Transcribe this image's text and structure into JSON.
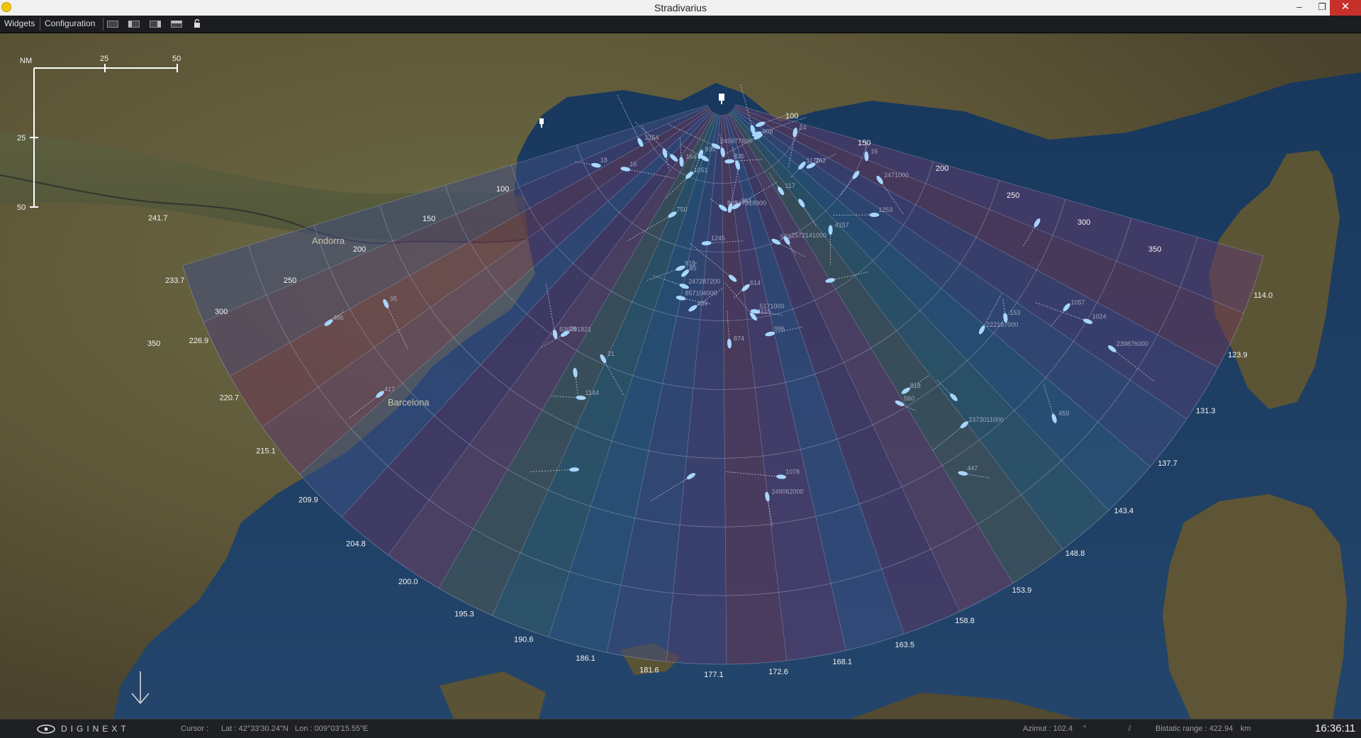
{
  "window": {
    "title": "Stradivarius",
    "minimize": "–",
    "restore": "❐",
    "close": "✕"
  },
  "menu": {
    "widgets": "Widgets",
    "configuration": "Configuration",
    "tools": [
      "layout-1-icon",
      "layout-2-icon",
      "layout-3-icon",
      "layout-4-icon",
      "lock-icon"
    ]
  },
  "scale_bar": {
    "unit": "NM",
    "h_ticks": [
      "25",
      "50"
    ],
    "v_ticks": [
      "25",
      "50"
    ]
  },
  "place_labels": {
    "andorra": "Andorra",
    "barcelona": "Barcelona"
  },
  "range_rings_east": [
    "100",
    "150",
    "200",
    "250",
    "300",
    "350"
  ],
  "range_rings_west": [
    "100",
    "150",
    "200",
    "250",
    "300",
    "350"
  ],
  "arc_labels": [
    "114.0",
    "123.9",
    "131.3",
    "137.7",
    "143.4",
    "148.8",
    "153.9",
    "158.8",
    "163.5",
    "168.1",
    "172.6",
    "177.1",
    "181.6",
    "186.1",
    "190.6",
    "195.3",
    "200.0",
    "204.8",
    "209.9",
    "215.1",
    "220.7",
    "226.9",
    "233.7",
    "241.7"
  ],
  "track_ids": [
    "874",
    "242",
    "1115",
    "1057",
    "65",
    "560",
    "935",
    "865",
    "1051",
    "439",
    "908",
    "486",
    "1253",
    "1254",
    "995",
    "750",
    "459",
    "353",
    "1245",
    "222187000",
    "573",
    "1024",
    "2373011000",
    "247318900",
    "918",
    "636091821",
    "1178",
    "835",
    "2471000",
    "21",
    "18",
    "5171000",
    "1078",
    "614",
    "117",
    "164",
    "818",
    "417",
    "95",
    "28",
    "245977600",
    "2572141000",
    "4157",
    "1144",
    "447",
    "16",
    "247287200",
    "239876000",
    "249062000",
    "857104000",
    "153",
    "16",
    "24"
  ],
  "north_arrow": "north-arrow-icon",
  "status": {
    "logo": "DIGINEXT",
    "cursor_label": "Cursor :",
    "lat_label": "Lat : 42°33'30.24\"N",
    "lon_label": "Lon : 009°03'15.55\"E",
    "azimut_label": "Azimut : 102.4",
    "azimut_unit": "°",
    "separator": "/",
    "range_label": "Bistatic range : 422.94",
    "range_unit": "km",
    "clock": "16:36:11"
  },
  "colors": {
    "sea": "#1d3a5e",
    "land": "#5b5638",
    "coverage": "#4c3b6e",
    "ship": "#a8d6ff"
  }
}
